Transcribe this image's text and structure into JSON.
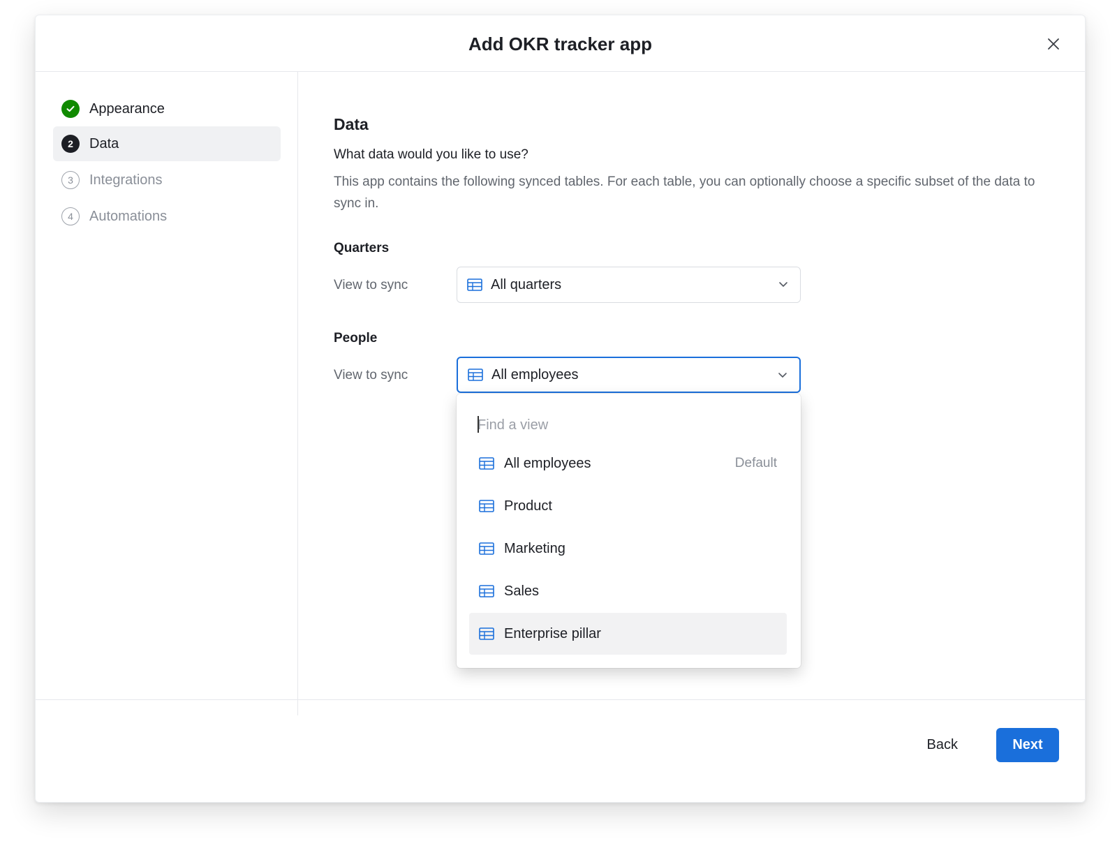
{
  "dialog": {
    "title": "Add OKR tracker app"
  },
  "steps": [
    {
      "number": "",
      "label": "Appearance",
      "state": "done"
    },
    {
      "number": "2",
      "label": "Data",
      "state": "current"
    },
    {
      "number": "3",
      "label": "Integrations",
      "state": "pending"
    },
    {
      "number": "4",
      "label": "Automations",
      "state": "pending"
    }
  ],
  "content": {
    "section_title": "Data",
    "question": "What data would you like to use?",
    "description": "This app contains the following synced tables. For each table, you can optionally choose a specific subset of the data to sync in.",
    "groups": [
      {
        "title": "Quarters",
        "field_label": "View to sync",
        "selected": "All quarters"
      },
      {
        "title": "People",
        "field_label": "View to sync",
        "selected": "All employees"
      }
    ]
  },
  "dropdown": {
    "search_placeholder": "Find a view",
    "options": [
      {
        "label": "All employees",
        "tag": "Default"
      },
      {
        "label": "Product",
        "tag": ""
      },
      {
        "label": "Marketing",
        "tag": ""
      },
      {
        "label": "Sales",
        "tag": ""
      },
      {
        "label": "Enterprise pillar",
        "tag": ""
      }
    ],
    "hovered_option": "Enterprise pillar"
  },
  "footer": {
    "back_label": "Back",
    "next_label": "Next"
  },
  "colors": {
    "accent": "#1a6fdb",
    "success": "#108a00",
    "text": "#1d1f25",
    "muted": "#8a8f98"
  }
}
